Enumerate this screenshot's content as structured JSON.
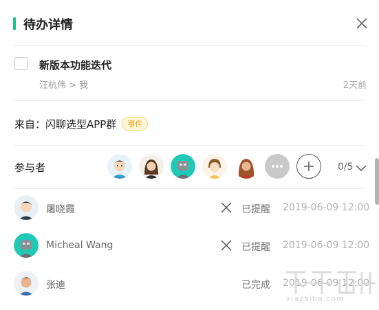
{
  "header": {
    "title": "待办详情"
  },
  "task": {
    "title": "新版本功能迭代",
    "path": "汪杭伟 > 我",
    "time": "2天前",
    "checked": false
  },
  "source": {
    "label": "来自：闪聊选型APP群",
    "badge": "事件"
  },
  "participants": {
    "label": "参与者",
    "count": "0/5",
    "avatars": [
      "avatar-1",
      "avatar-2",
      "avatar-3",
      "avatar-4",
      "avatar-5"
    ]
  },
  "reminders": [
    {
      "name": "屠晓霞",
      "status": "已提醒",
      "time": "2019-06-09  12:00",
      "removable": true
    },
    {
      "name": "Micheal Wang",
      "status": "已提醒",
      "time": "2019-06-09  12:00",
      "removable": true
    },
    {
      "name": "张迪",
      "status": "已完成",
      "time": "2019-06-09  12:00",
      "removable": false
    }
  ],
  "watermark": {
    "text": "xiazaiba.com"
  },
  "colors": {
    "accent": "#19c18c",
    "badge": "#e8a31c",
    "muted": "#9a9a9a"
  }
}
